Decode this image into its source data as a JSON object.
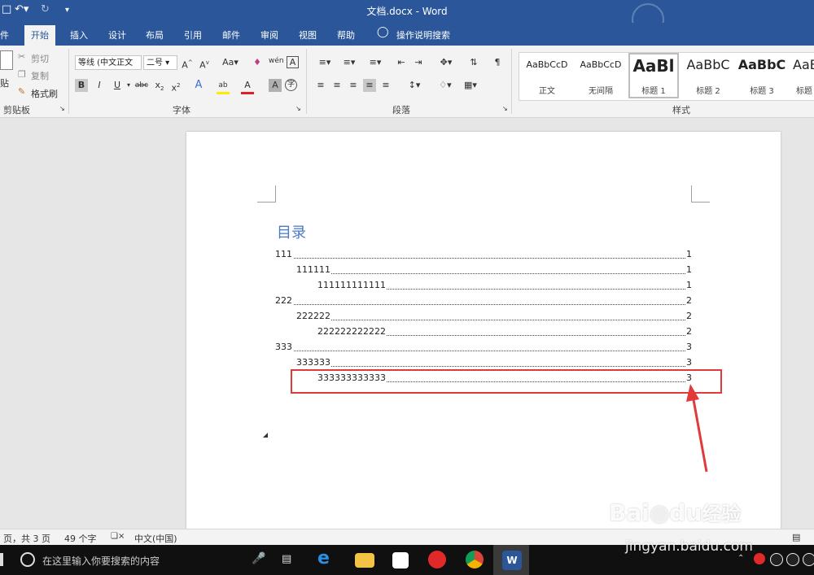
{
  "window": {
    "title": "文档.docx  -  Word"
  },
  "tabs": [
    "件",
    "开始",
    "插入",
    "设计",
    "布局",
    "引用",
    "邮件",
    "审阅",
    "视图",
    "帮助",
    "操作说明搜索"
  ],
  "ribbon": {
    "clipboard": {
      "paste": "贴",
      "cut": "剪切",
      "copy": "复制",
      "format_painter": "格式刷",
      "label": "剪贴板"
    },
    "font": {
      "font_name": "等线 (中文正文",
      "font_size": "二号",
      "label": "字体"
    },
    "paragraph": {
      "label": "段落"
    },
    "styles": {
      "label": "样式",
      "items": [
        {
          "sample": "AaBbCcD",
          "name": "正文"
        },
        {
          "sample": "AaBbCcD",
          "name": "无间隔"
        },
        {
          "sample": "AaBl",
          "name": "标题 1"
        },
        {
          "sample": "AaBbC",
          "name": "标题 2"
        },
        {
          "sample": "AaBbC",
          "name": "标题 3"
        },
        {
          "sample": "AaB",
          "name": "标题"
        }
      ]
    }
  },
  "document": {
    "toc_title": "目录",
    "toc_entries": [
      {
        "text": "111",
        "page": "1",
        "level": 1
      },
      {
        "text": "111111",
        "page": "1",
        "level": 2
      },
      {
        "text": "111111111111",
        "page": "1",
        "level": 3
      },
      {
        "text": "222",
        "page": "2",
        "level": 1
      },
      {
        "text": "222222",
        "page": "2",
        "level": 2
      },
      {
        "text": "222222222222",
        "page": "2",
        "level": 3
      },
      {
        "text": "333",
        "page": "3",
        "level": 1
      },
      {
        "text": "333333",
        "page": "3",
        "level": 2
      },
      {
        "text": "333333333333",
        "page": "3",
        "level": 3
      }
    ]
  },
  "statusbar": {
    "pages": "页，共 3 页",
    "words": "49 个字",
    "language": "中文(中国)"
  },
  "taskbar": {
    "search_placeholder": "在这里输入你要搜索的内容"
  },
  "watermark": {
    "brand": "Bai",
    "brand2": "du",
    "brand_cn": "经验",
    "url": "jingyan.baidu.com"
  },
  "colors": {
    "word_blue": "#2b579a",
    "toc_title": "#4a78c2",
    "highlight": "#e03a3a"
  }
}
